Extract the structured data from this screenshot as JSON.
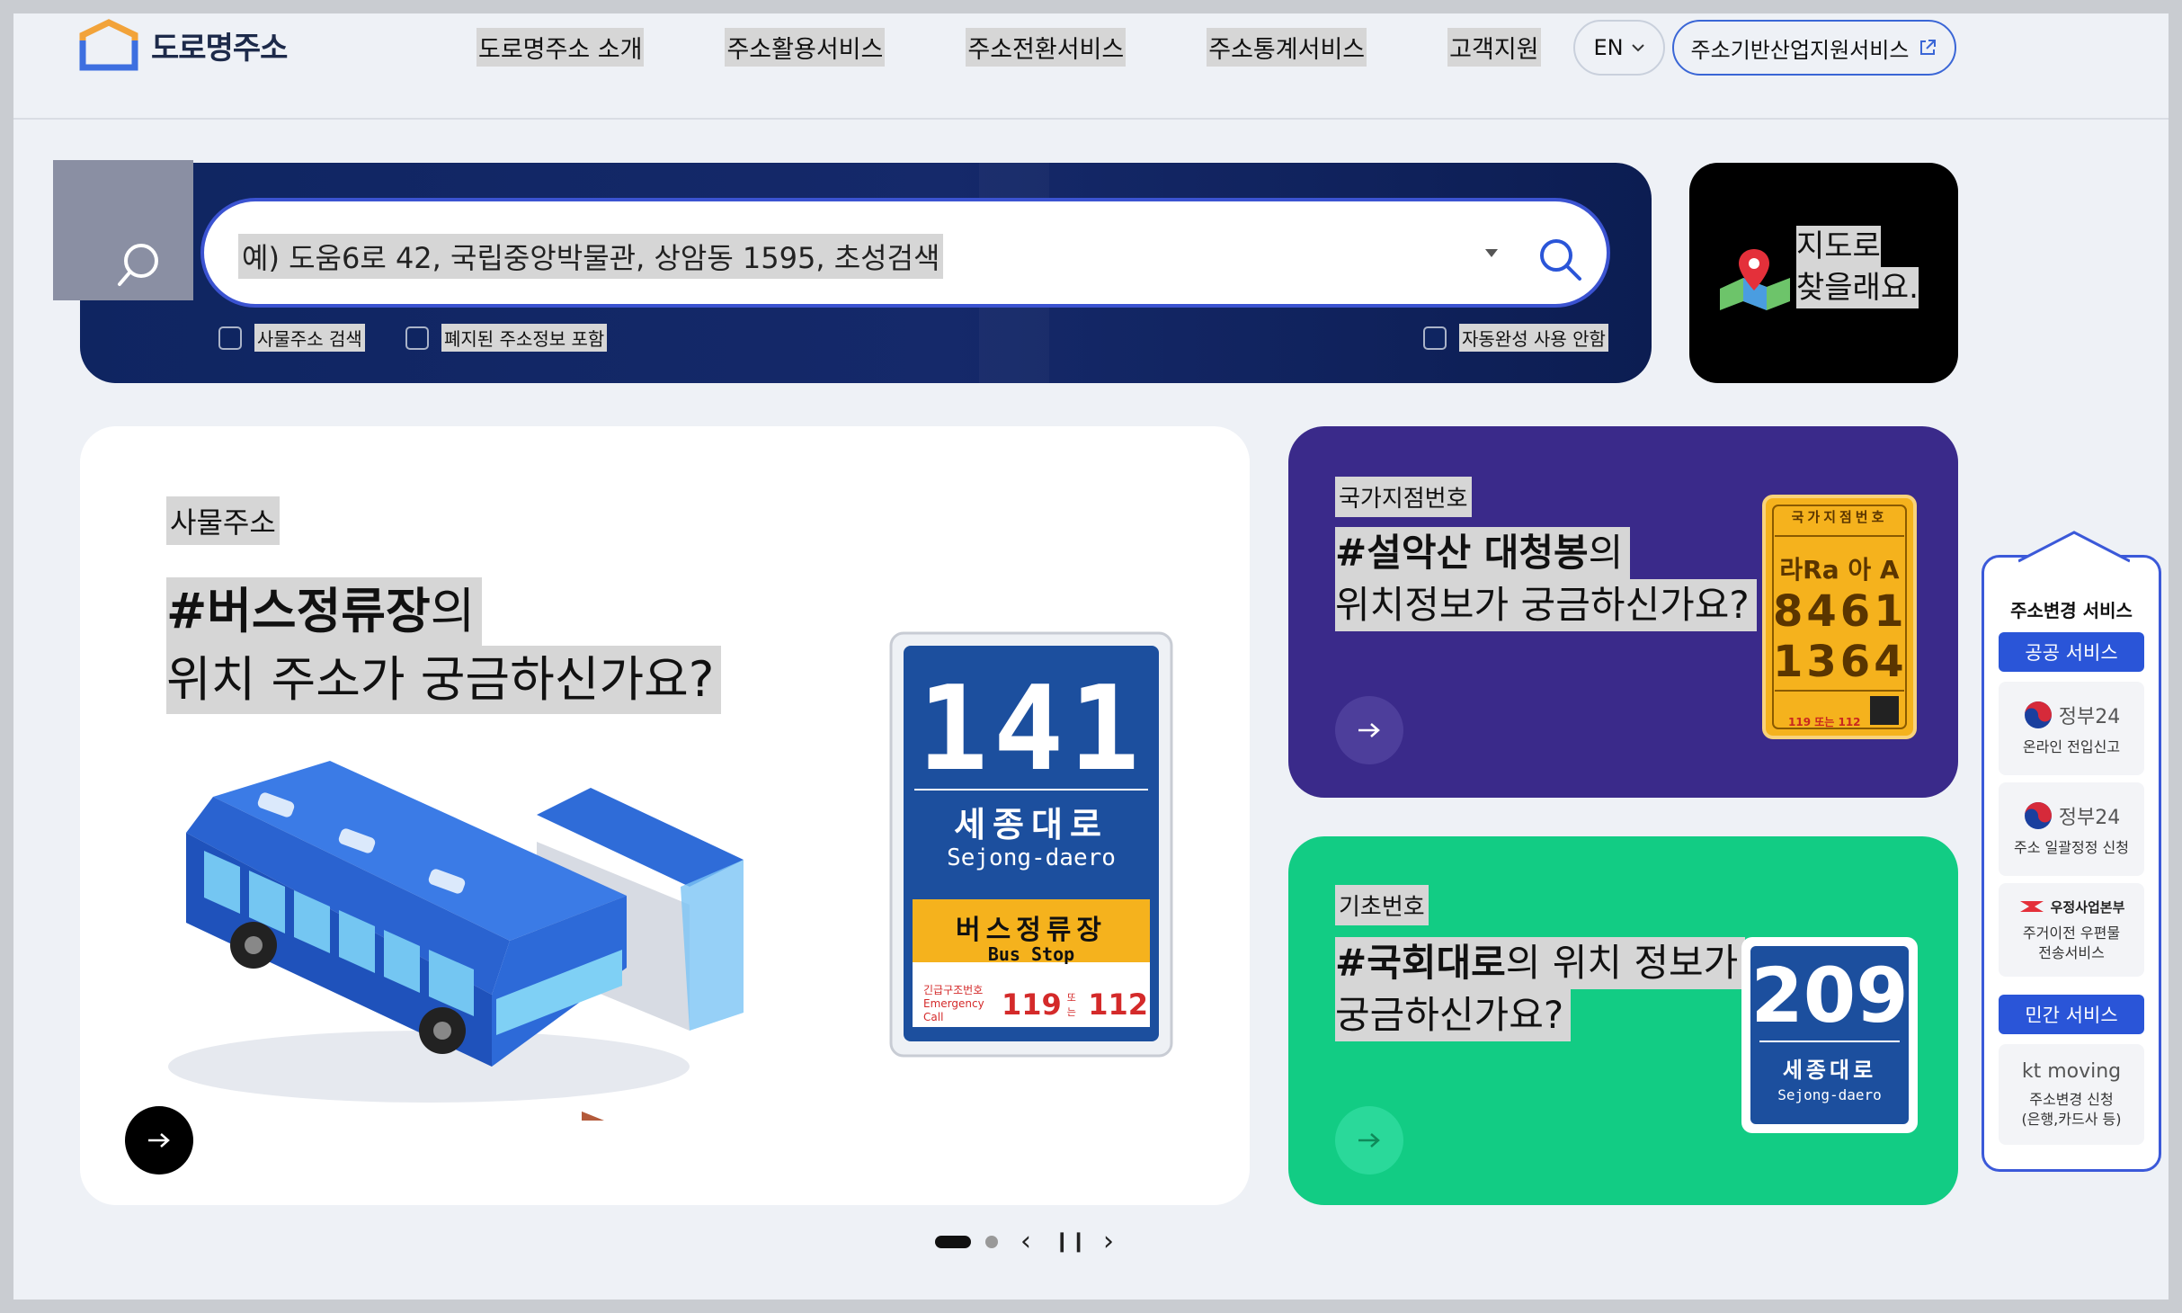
{
  "header": {
    "logo_text": "도로명주소",
    "nav": [
      "도로명주소 소개",
      "주소활용서비스",
      "주소전환서비스",
      "주소통계서비스",
      "고객지원"
    ],
    "lang_label": "EN",
    "biz_label": "주소기반산업지원서비스"
  },
  "search": {
    "placeholder": "예) 도움6로 42, 국립중앙박물관, 상암동 1595, 초성검색",
    "options": [
      "사물주소 검색",
      "폐지된 주소정보 포함"
    ],
    "autocomplete_off": "자동완성 사용 안함"
  },
  "map_card": {
    "line1": "지도로",
    "line2": "찾을래요."
  },
  "card_main": {
    "tag": "사물주소",
    "headline_bold": "#버스정류장",
    "headline_rest": "의",
    "headline_line2": "위치 주소가 궁금하신가요?",
    "sign": {
      "number": "141",
      "road_ko": "세종대로",
      "road_en": "Sejong-daero",
      "stop_ko": "버스정류장",
      "stop_en": "Bus Stop",
      "emerg_label": "긴급구조번호",
      "emerg_label_en": "Emergency Call",
      "num1": "119",
      "or": "또는",
      "num2": "112"
    }
  },
  "card_purple": {
    "tag": "국가지점번호",
    "headline_bold": "#설악산 대청봉",
    "headline_rest": "의",
    "headline_line2": "위치정보가 궁금하신가요?",
    "sign": {
      "title": "국가지점번호",
      "line1": "라Ra 아 A",
      "line2": "8461",
      "line3": "1364",
      "foot": "119 또는 112"
    }
  },
  "card_green": {
    "tag": "기초번호",
    "headline_bold": "#국회대로",
    "headline_rest": "의 위치 정보가",
    "headline_line2": "궁금하신가요?",
    "sign": {
      "number": "209",
      "road_ko": "세종대로",
      "road_en": "Sejong-daero"
    }
  },
  "side_panel": {
    "title": "주소변경 서비스",
    "public_label": "공공 서비스",
    "private_label": "민간 서비스",
    "services": [
      {
        "logo": "정부24",
        "desc": "온라인 전입신고"
      },
      {
        "logo": "정부24",
        "desc": "주소 일괄정정 신청"
      },
      {
        "logo": "우정사업본부",
        "desc": "주거이전 우편물\n전송서비스"
      },
      {
        "logo": "kt moving",
        "desc": "주소변경 신청\n(은행,카드사 등)"
      }
    ]
  },
  "pager": {
    "prev": "‹",
    "pause": "❙❙",
    "next": "›"
  },
  "colors": {
    "navy": "#0f2561",
    "purple": "#3a2a8a",
    "green": "#12cc84",
    "accent_blue": "#2a55d8",
    "sign_blue": "#1c4f9e",
    "sign_yellow": "#f5b21d"
  }
}
